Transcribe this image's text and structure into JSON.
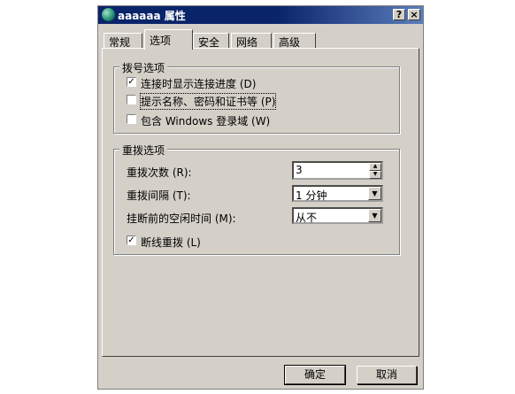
{
  "window": {
    "title": "aaaaaa 属性",
    "help_glyph": "?",
    "close_glyph": "×"
  },
  "tabs": [
    {
      "label": "常规"
    },
    {
      "label": "选项"
    },
    {
      "label": "安全"
    },
    {
      "label": "网络"
    },
    {
      "label": "高级"
    }
  ],
  "active_tab": "选项",
  "dialing_group": {
    "title": "拨号选项",
    "options": [
      {
        "label": "连接时显示连接进度 (D)",
        "checked": true,
        "check_glyph": "✓"
      },
      {
        "label": "提示名称、密码和证书等 (P)",
        "checked": false,
        "check_glyph": ""
      },
      {
        "label": "包含 Windows 登录域 (W)",
        "checked": false,
        "check_glyph": ""
      }
    ]
  },
  "redial_group": {
    "title": "重拨选项",
    "attempts": {
      "label": "重拨次数 (R):",
      "value": "3",
      "up": "▲",
      "down": "▼"
    },
    "interval": {
      "label": "重拨间隔 (T):",
      "value": "1 分钟",
      "arrow": "▼"
    },
    "idle": {
      "label": "挂断前的空闲时间 (M):",
      "value": "从不",
      "arrow": "▼"
    },
    "redial_on_drop": {
      "label": "断线重拨 (L)",
      "checked": true,
      "check_glyph": "✓"
    }
  },
  "buttons": {
    "ok": "确定",
    "cancel": "取消"
  }
}
